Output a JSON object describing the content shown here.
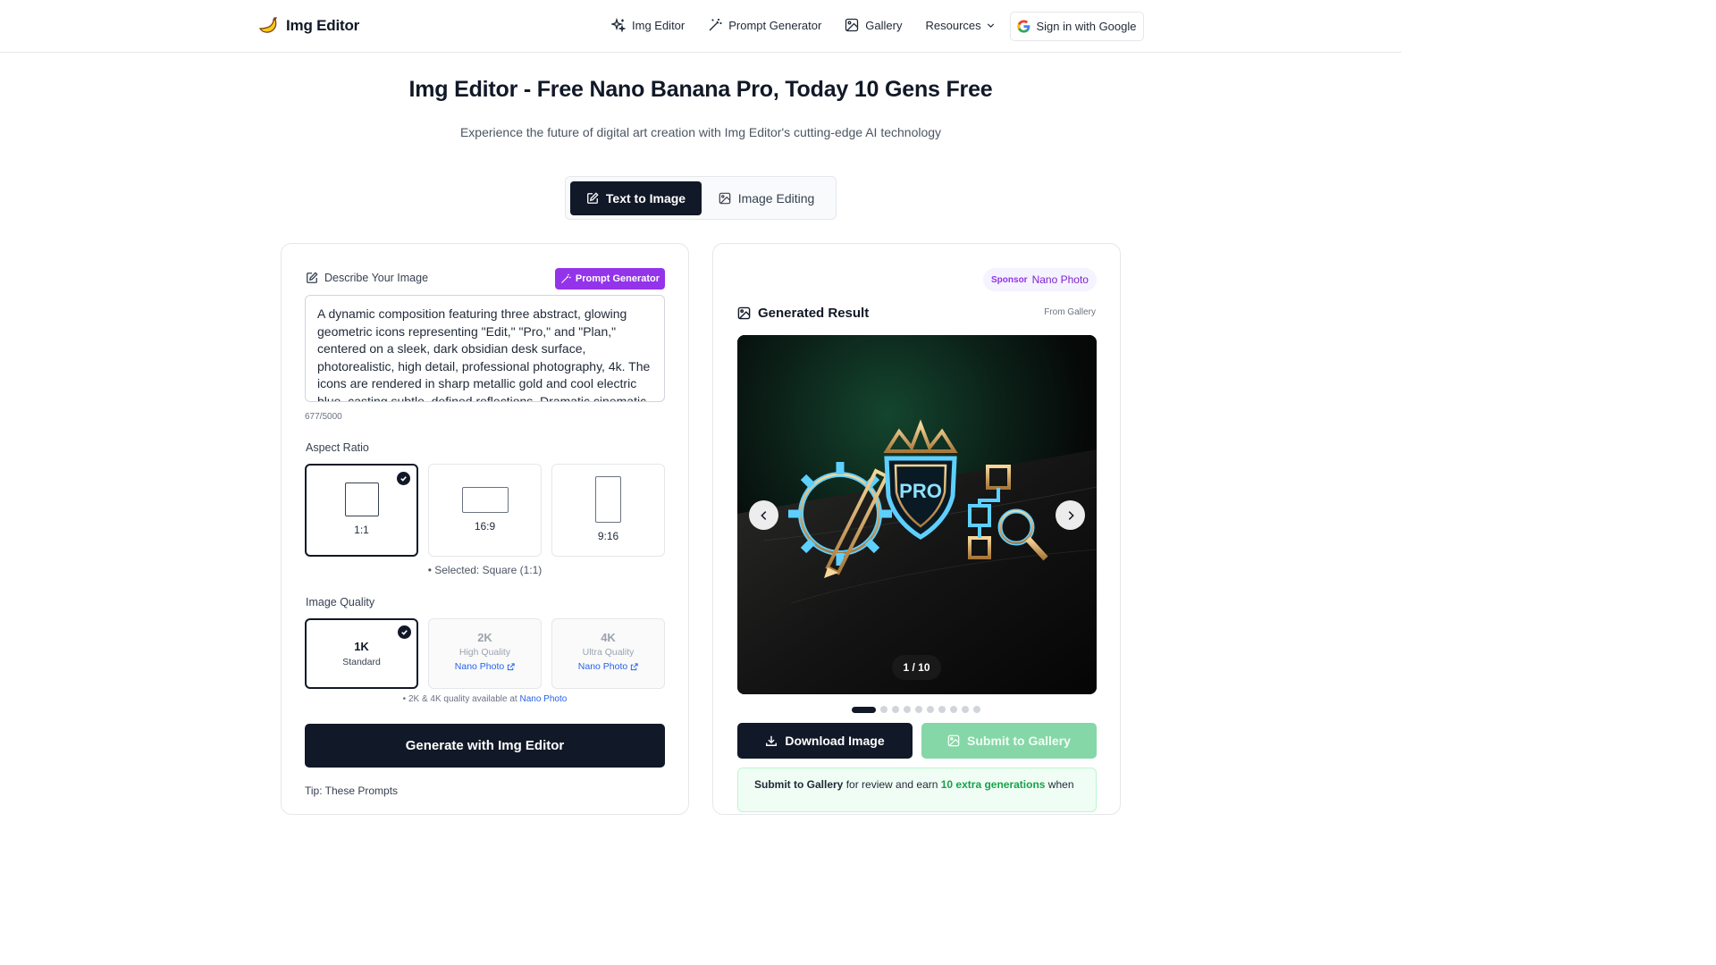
{
  "brand": {
    "name": "Img Editor"
  },
  "nav": {
    "items": [
      {
        "label": "Img Editor",
        "icon": "sparkles-icon"
      },
      {
        "label": "Prompt Generator",
        "icon": "magic-wand-icon"
      },
      {
        "label": "Gallery",
        "icon": "image-icon"
      },
      {
        "label": "Resources",
        "icon": "chevron-down-icon"
      }
    ],
    "signin_label": "Sign in with Google"
  },
  "hero": {
    "title": "Img Editor - Free Nano Banana Pro, Today 10 Gens Free",
    "subtitle": "Experience the future of digital art creation with Img Editor's cutting-edge AI technology"
  },
  "mode_tabs": {
    "text_to_image": "Text to Image",
    "image_editing": "Image Editing",
    "active": "text_to_image"
  },
  "left": {
    "describe_label": "Describe Your Image",
    "prompt_generator_label": "Prompt Generator",
    "prompt_text": "A dynamic composition featuring three abstract, glowing geometric icons representing \"Edit,\" \"Pro,\" and \"Plan,\" centered on a sleek, dark obsidian desk surface, photorealistic, high detail, professional photography, 4k. The icons are rendered in sharp metallic gold and cool electric blue, casting subtle, defined reflections. Dramatic cinematic",
    "char_count": "677/5000",
    "aspect_label": "Aspect Ratio",
    "ratios": [
      {
        "label": "1:1",
        "selected": true
      },
      {
        "label": "16:9",
        "selected": false
      },
      {
        "label": "9:16",
        "selected": false
      }
    ],
    "selected_note": "• Selected: Square (1:1)",
    "quality_label": "Image Quality",
    "qualities": [
      {
        "title": "1K",
        "sub": "Standard",
        "link": "",
        "selected": true
      },
      {
        "title": "2K",
        "sub": "High Quality",
        "link": "Nano Photo",
        "selected": false
      },
      {
        "title": "4K",
        "sub": "Ultra Quality",
        "link": "Nano Photo",
        "selected": false
      }
    ],
    "quality_note_prefix": "• 2K & 4K quality available at",
    "quality_note_link": "Nano Photo",
    "generate_label": "Generate with Img Editor",
    "cut_text": "Tip: These Prompts"
  },
  "right": {
    "sponsor_tag": "Sponsor",
    "sponsor_name": "Nano Photo",
    "result_title": "Generated Result",
    "from_gallery": "From Gallery",
    "counter": "1 / 10",
    "dots_total": 10,
    "dots_active_index": 0,
    "download_label": "Download Image",
    "submit_label": "Submit to Gallery",
    "banner_bold": "Submit to Gallery",
    "banner_mid": " for review and earn ",
    "banner_green": "10 extra generations",
    "banner_end": " when"
  },
  "colors": {
    "primary": "#111827",
    "purple": "#9333ea",
    "link_blue": "#2563eb",
    "submit_green": "#86d7a7",
    "accent_green": "#16a34a"
  }
}
